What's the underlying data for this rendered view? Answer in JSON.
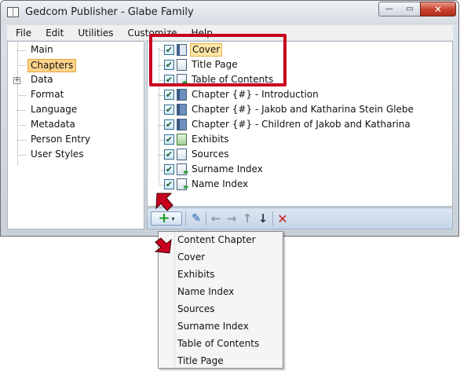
{
  "window": {
    "title": "Gedcom Publisher - Glabe Family",
    "min_label": "—",
    "max_label": "▭",
    "close_label": "✕"
  },
  "menu": [
    "File",
    "Edit",
    "Utilities",
    "Customize",
    "Help"
  ],
  "nav": {
    "items": [
      "Main",
      "Chapters",
      "Data",
      "Format",
      "Language",
      "Metadata",
      "Person Entry",
      "User Styles"
    ],
    "selected": "Chapters",
    "expander_label": "+"
  },
  "chapters": [
    {
      "label": "Cover",
      "icon": "cover-book-icon",
      "checked": true,
      "highlighted": true
    },
    {
      "label": "Title Page",
      "icon": "page-icon",
      "checked": true,
      "highlighted": false
    },
    {
      "label": "Table of Contents",
      "icon": "toc-icon",
      "checked": true,
      "highlighted": false
    },
    {
      "label": "Chapter {#} - Introduction",
      "icon": "chapter-icon",
      "checked": true,
      "highlighted": false
    },
    {
      "label": "Chapter {#} - Jakob and Katharina Stein Glebe",
      "icon": "chapter-icon",
      "checked": true,
      "highlighted": false
    },
    {
      "label": "Chapter {#} - Children of Jakob and Katharina",
      "icon": "chapter-icon",
      "checked": true,
      "highlighted": false
    },
    {
      "label": "Exhibits",
      "icon": "exhibits-icon",
      "checked": true,
      "highlighted": false
    },
    {
      "label": "Sources",
      "icon": "sources-icon",
      "checked": true,
      "highlighted": false
    },
    {
      "label": "Surname Index",
      "icon": "index-icon",
      "checked": true,
      "highlighted": false
    },
    {
      "label": "Name Index",
      "icon": "index-icon",
      "checked": true,
      "highlighted": false
    }
  ],
  "checkmark": "✔",
  "toolbar": {
    "add": "+",
    "caret": "▾",
    "edit": "✎",
    "move_left": "←",
    "move_right": "→",
    "move_up": "↑",
    "move_down": "↓",
    "delete": "✕"
  },
  "add_menu": [
    "Content Chapter",
    "Cover",
    "Exhibits",
    "Name Index",
    "Sources",
    "Surname Index",
    "Table of Contents",
    "Title Page"
  ],
  "colors": {
    "callout": "#c8001e",
    "selection": "#ffd38a",
    "add_green": "#1e9b22"
  }
}
